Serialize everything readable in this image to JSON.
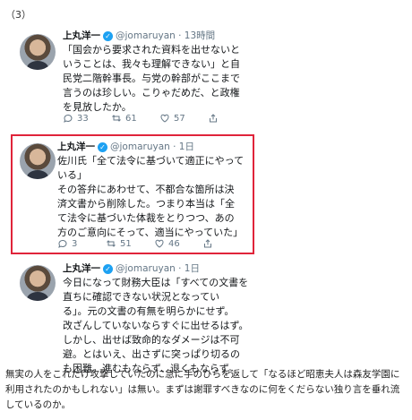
{
  "section_label": "（3）",
  "tweets": [
    {
      "name": "上丸洋一",
      "handle": "@jomaruyan",
      "time": "13時間",
      "text": "「国会から要求された資料を出せないと\nいうことは、我々も理解できない」と自\n民党二階幹事長。与党の幹部がここまで\n言うのは珍しい。こりゃだめだ、と政権\nを見放したか。",
      "reply_count": "33",
      "retweet_count": "61",
      "like_count": "57"
    },
    {
      "name": "上丸洋一",
      "handle": "@jomaruyan",
      "time": "1日",
      "text": "佐川氏「全て法令に基づいて適正にやって\nいる」\nその答弁にあわせて、不都合な箇所は決\n済文書から削除した。つまり本当は「全\nて法令に基づいた体裁をとりつつ、あの\n方のご意向にそって、適当にやっていた」",
      "reply_count": "3",
      "retweet_count": "51",
      "like_count": "46"
    },
    {
      "name": "上丸洋一",
      "handle": "@jomaruyan",
      "time": "1日",
      "text": "今日になって財務大臣は「すべての文書を\n直ちに確認できない状況となってい\nる」。元の文書の有無を明らかにせず。\n改ざんしていないならすぐに出せるはず。\nしかし、出せば致命的なダメージは不可\n避。とはいえ、出さずに突っぱり切るの\nも困難。進むもならず、退くもならず。"
    }
  ],
  "footer_text": "無実の人をこれだけ攻撃していたのに急に手のひらを返して「なるほど昭恵夫人は森友学園に利用されたのかもしれない」は無い。まずは謝罪すべきなのに何をくだらない独り言を垂れ流しているのか。",
  "colors": {
    "highlight_border": "#e0243a",
    "verified": "#1da1f2",
    "muted": "#657786"
  }
}
